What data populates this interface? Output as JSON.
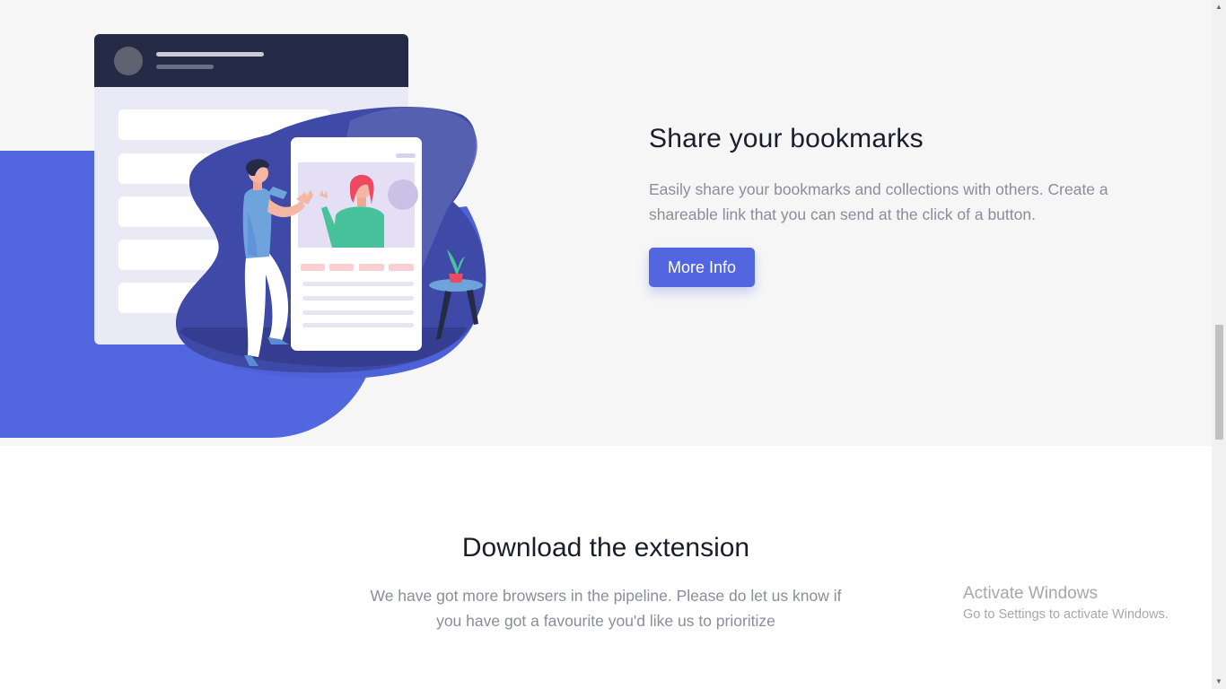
{
  "feature": {
    "title": "Share your bookmarks",
    "description": "Easily share your bookmarks and collections with others. Create a shareable link that you can send at the click of a button.",
    "button_label": "More Info"
  },
  "download": {
    "title": "Download the extension",
    "description": "We have got more browsers in the pipeline. Please do let us know if you have got a favourite you'd like us to prioritize"
  },
  "watermark": {
    "title": "Activate Windows",
    "subtitle": "Go to Settings to activate Windows."
  },
  "scrollbar": {
    "up_icon": "▲",
    "down_icon": "▼"
  },
  "colors": {
    "accent": "#5267df",
    "dark_navy": "#252b46",
    "section_bg": "#f6f6f7",
    "muted_text": "#8a8d9a"
  },
  "icons": [
    "person-illustration",
    "avatar-illustration",
    "plant-icon"
  ]
}
